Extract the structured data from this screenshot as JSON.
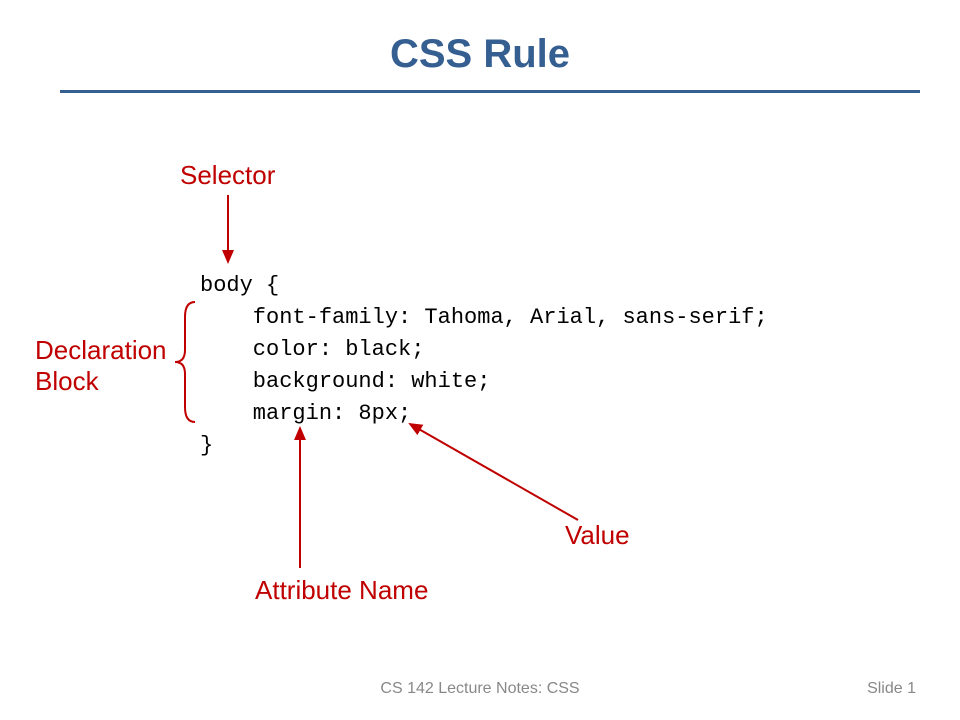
{
  "title": "CSS Rule",
  "annotations": {
    "selector": "Selector",
    "declaration_block": "Declaration\nBlock",
    "attribute_name": "Attribute Name",
    "value": "Value"
  },
  "code": {
    "line1": "body {",
    "line2": "    font-family: Tahoma, Arial, sans-serif;",
    "line3": "    color: black;",
    "line4": "    background: white;",
    "line5": "    margin: 8px;",
    "line6": "}"
  },
  "footer": {
    "course": "CS 142 Lecture Notes: CSS",
    "slide_number": "Slide 1"
  },
  "colors": {
    "title": "#355f91",
    "annotation": "#c00000",
    "footer": "#888888"
  }
}
